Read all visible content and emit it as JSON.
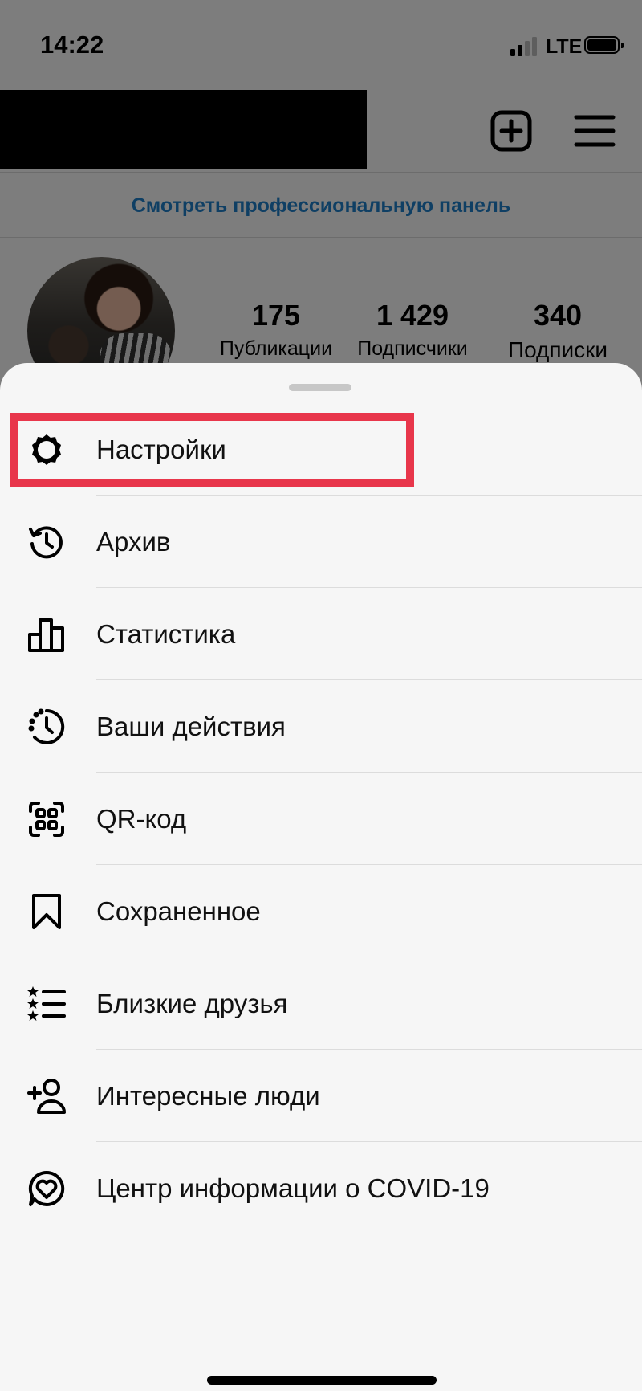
{
  "status_bar": {
    "time": "14:22",
    "network": "LTE"
  },
  "header": {
    "pro_dashboard_link": "Смотреть профессиональную панель",
    "icons": [
      "new-post-icon",
      "hamburger-menu-icon"
    ]
  },
  "profile": {
    "stats": [
      {
        "value": "175",
        "label": "Публикации"
      },
      {
        "value": "1 429",
        "label": "Подписчики"
      },
      {
        "value": "340",
        "label": "Подписки"
      }
    ]
  },
  "menu": {
    "items": [
      {
        "label": "Настройки",
        "icon": "settings-gear-icon",
        "highlighted": true
      },
      {
        "label": "Архив",
        "icon": "archive-history-icon"
      },
      {
        "label": "Статистика",
        "icon": "insights-bar-chart-icon"
      },
      {
        "label": "Ваши действия",
        "icon": "your-activity-icon"
      },
      {
        "label": "QR-код",
        "icon": "qr-code-icon"
      },
      {
        "label": "Сохраненное",
        "icon": "bookmark-icon"
      },
      {
        "label": "Близкие друзья",
        "icon": "close-friends-list-icon"
      },
      {
        "label": "Интересные люди",
        "icon": "discover-people-icon"
      },
      {
        "label": "Центр информации о COVID-19",
        "icon": "covid-info-heart-icon"
      }
    ]
  },
  "colors": {
    "highlight": "#e8364b",
    "link": "#1f7fc8",
    "sheet_bg": "#f6f6f6"
  }
}
